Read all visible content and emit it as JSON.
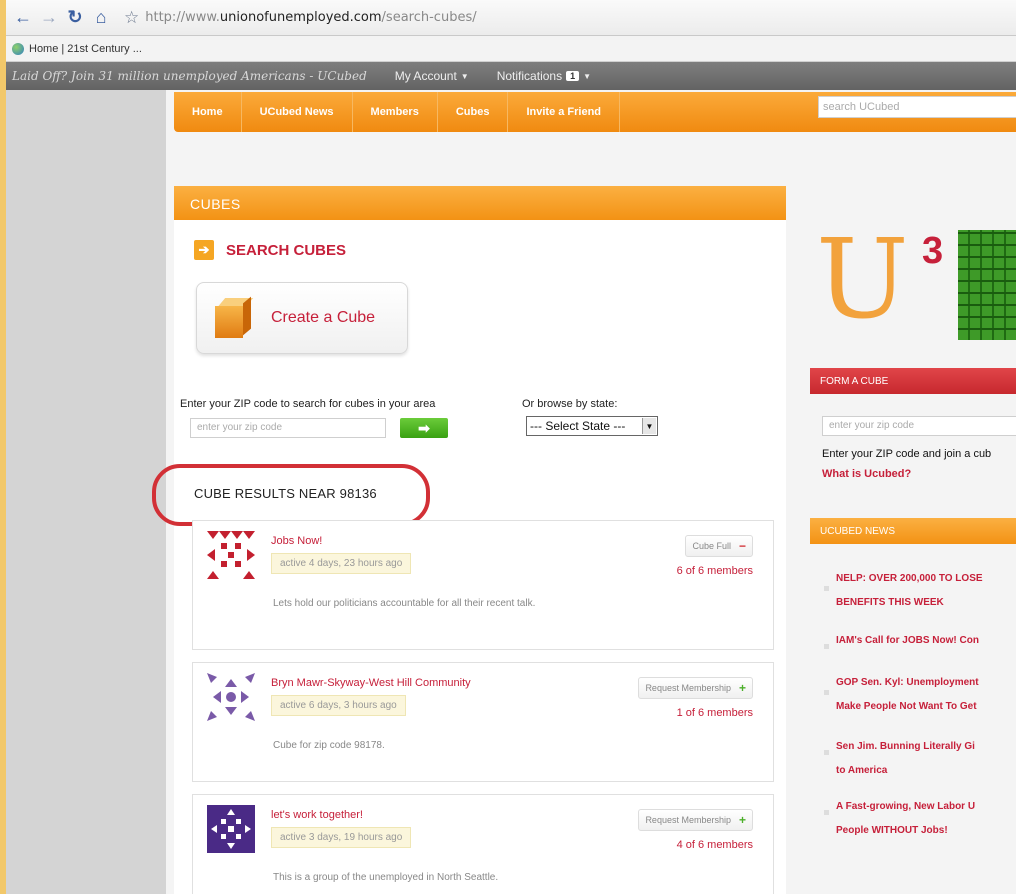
{
  "browser": {
    "url_prefix": "http://www.",
    "url_domain": "unionofunemployed.com",
    "url_path": "/search-cubes/",
    "bookmark": "Home | 21st Century ..."
  },
  "site_bar": {
    "tagline": "Laid Off? Join 31 million unemployed Americans - UCubed",
    "my_account": "My Account",
    "notifications": "Notifications",
    "notification_count": "1"
  },
  "nav": {
    "items": [
      "Home",
      "UCubed News",
      "Members",
      "Cubes",
      "Invite a Friend"
    ],
    "search_placeholder": "search UCubed"
  },
  "main": {
    "section_header": "CUBES",
    "search_title": "SEARCH CUBES",
    "create_label": "Create a Cube",
    "zip_label": "Enter your ZIP code to search for cubes in your area",
    "zip_placeholder": "enter your zip code",
    "go_arrow": "➡",
    "state_label": "Or browse by state:",
    "state_selected": "--- Select State ---",
    "results_title": "CUBE RESULTS NEAR 98136"
  },
  "cubes": [
    {
      "name": "Jobs Now!",
      "active": "active 4 days, 23 hours ago",
      "button": "Cube Full",
      "button_sign": "−",
      "members": "6 of 6 members",
      "description": "Lets hold our politicians accountable for all their recent talk."
    },
    {
      "name": "Bryn Mawr-Skyway-West Hill Community",
      "active": "active 6 days, 3 hours ago",
      "button": "Request Membership",
      "button_sign": "+",
      "members": "1 of 6 members",
      "description": "Cube for zip code 98178."
    },
    {
      "name": "let's work together!",
      "active": "active 3 days, 19 hours ago",
      "button": "Request Membership",
      "button_sign": "+",
      "members": "4 of 6 members",
      "description": "This is a group of the unemployed in North Seattle."
    }
  ],
  "right": {
    "logo_u": "U",
    "logo_sup": "3",
    "form_header": "FORM A CUBE",
    "form_zip_placeholder": "enter your zip code",
    "form_note": "Enter your ZIP code and join a cub",
    "what_is": "What is Ucubed?",
    "news_header": "UCUBED NEWS",
    "news": [
      "NELP: OVER 200,000 TO LOSE",
      "BENEFITS THIS WEEK",
      "IAM's Call for JOBS Now! Con",
      "GOP Sen. Kyl: Unemployment",
      "Make People Not Want To Get",
      "Sen Jim. Bunning Literally Gi",
      "to America",
      "A Fast-growing, New Labor U",
      "People WITHOUT Jobs!"
    ]
  },
  "colors": {
    "accent_orange": "#f39214",
    "accent_red": "#c6203a",
    "highlight_circle": "#d23036"
  }
}
